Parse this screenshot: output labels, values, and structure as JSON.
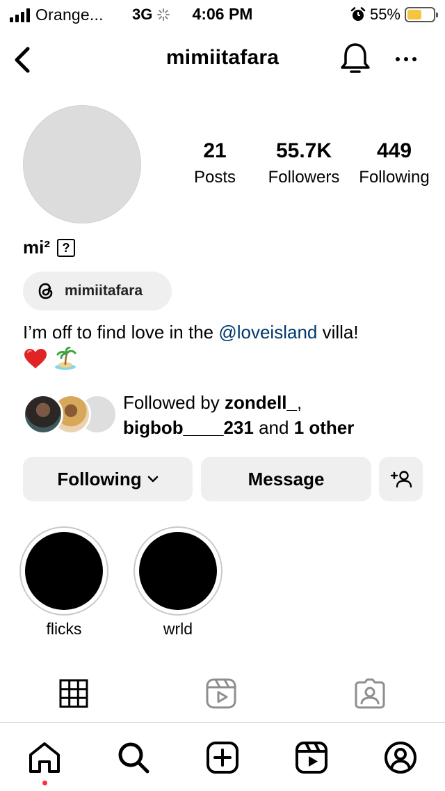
{
  "status_bar": {
    "carrier": "Orange...",
    "network": "3G",
    "time": "4:06 PM",
    "battery_percent": "55%",
    "battery_level": 0.55,
    "battery_color": "#f5c542"
  },
  "header": {
    "title": "mimiitafara",
    "back_icon": "chevron-left-icon",
    "bell_icon": "bell-icon",
    "more_icon": "more-horizontal-icon"
  },
  "profile": {
    "stats": {
      "posts_count": "21",
      "posts_label": "Posts",
      "followers_count": "55.7K",
      "followers_label": "Followers",
      "following_count": "449",
      "following_label": "Following"
    },
    "display_name": "mi²",
    "unsupported_glyph": "?",
    "threads_handle": "mimiitafara",
    "bio_prefix": "I’m off to find love in the ",
    "bio_mention": "@loveisland",
    "bio_suffix": " villa!",
    "bio_emoji": [
      "heart-emoji",
      "island-emoji"
    ],
    "followed_by_prefix": "Followed by ",
    "followed_by_user1": "zondell_",
    "followed_by_sep": ",",
    "followed_by_user2": "bigbob____231",
    "followed_by_and": " and ",
    "followed_by_other": "1 other"
  },
  "actions": {
    "following_label": "Following",
    "message_label": "Message"
  },
  "highlights": [
    {
      "label": "flicks"
    },
    {
      "label": "wrld"
    }
  ],
  "tabs": [
    "grid-icon",
    "reels-icon",
    "tagged-icon"
  ],
  "bottom_nav": [
    "home-icon",
    "search-icon",
    "create-icon",
    "reels-icon",
    "profile-icon"
  ],
  "colors": {
    "mention": "#00376b",
    "button_bg": "#efefef",
    "notification_dot": "#ff3040"
  }
}
